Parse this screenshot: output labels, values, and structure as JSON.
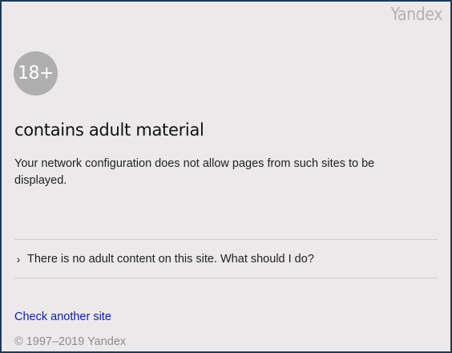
{
  "brand": "Yandex",
  "age_badge": "18+",
  "title": "contains adult material",
  "description": "Your network configuration does not allow pages from such sites to be displayed.",
  "expander": {
    "icon": "chevron-right-icon",
    "chevron": "›",
    "label": "There is no adult content on this site. What should I do?"
  },
  "link_label": "Check another site",
  "copyright": "© 1997–2019 Yandex",
  "colors": {
    "background": "#ece9ea",
    "border": "#1f3a55",
    "link": "#0a1fa8",
    "badge": "#b0afb0"
  }
}
